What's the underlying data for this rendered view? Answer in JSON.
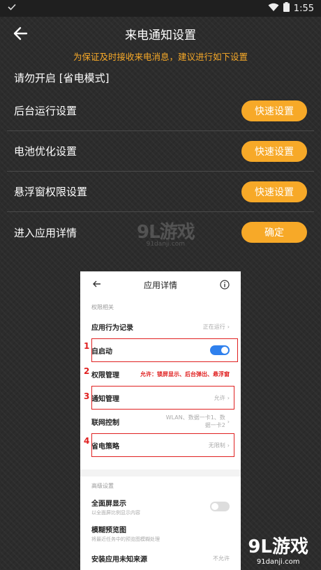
{
  "status": {
    "time": "1:55"
  },
  "header": {
    "title": "来电通知设置"
  },
  "notice": "为保证及时接收来电消息，建议进行如下设置",
  "rows": [
    {
      "label": "请勿开启 [省电模式]"
    },
    {
      "label": "后台运行设置",
      "button": "快速设置"
    },
    {
      "label": "电池优化设置",
      "button": "快速设置"
    },
    {
      "label": "悬浮窗权限设置",
      "button": "快速设置"
    },
    {
      "label": "进入应用详情",
      "button": "确定"
    }
  ],
  "watermark": {
    "logo": "9L游戏",
    "site": "91danji.com"
  },
  "screenshot": {
    "title": "应用详情",
    "section1": "权限相关",
    "items": [
      {
        "label": "应用行为记录",
        "value": "正在运行"
      },
      {
        "label": "自启动"
      },
      {
        "label": "权限管理",
        "note": "允许：锁屏显示、后台弹出、悬浮窗"
      },
      {
        "label": "通知管理",
        "value": "允许"
      },
      {
        "label": "联网控制",
        "value": "WLAN、数据一卡1、数据一卡2"
      },
      {
        "label": "省电策略",
        "value": "无限制"
      }
    ],
    "section2": "高级设置",
    "adv": [
      {
        "label": "全面屏显示",
        "sub": "以全面屏比例显示内容"
      },
      {
        "label": "模糊预览图",
        "sub": "将最近任务中的预览图模糊处理"
      },
      {
        "label": "安装应用未知来源",
        "value": "不允许"
      }
    ],
    "numbers": [
      "1",
      "2",
      "3",
      "4"
    ]
  },
  "colors": {
    "accent": "#f7a928",
    "annotation": "#e02020",
    "toggle": "#2f80ed"
  }
}
